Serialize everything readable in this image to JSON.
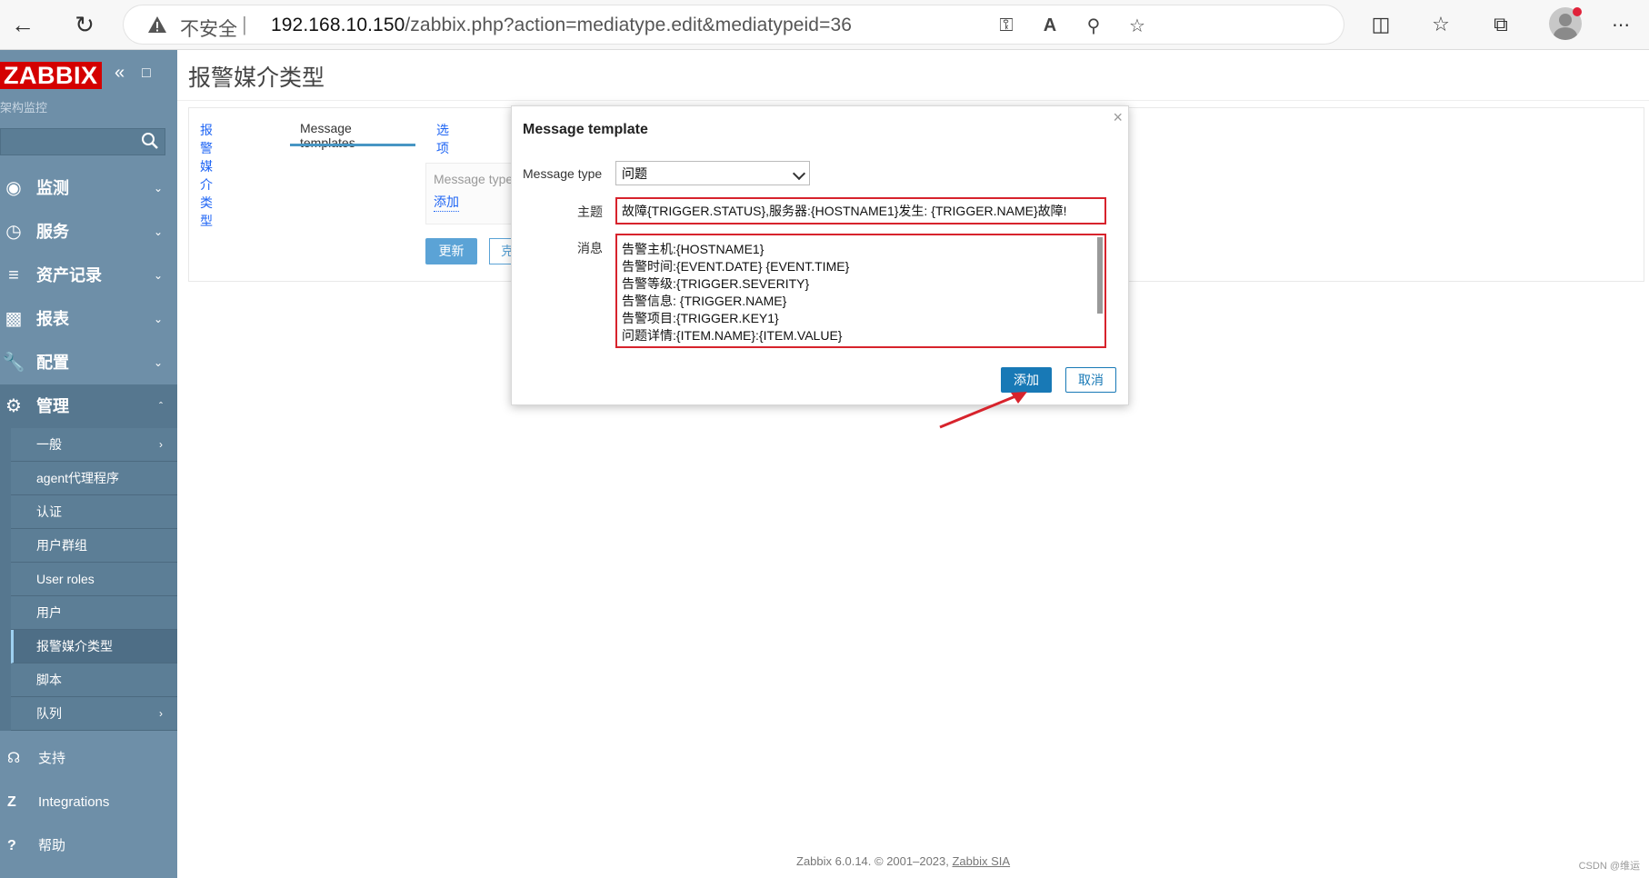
{
  "browser": {
    "security_label": "不安全",
    "url_host": "192.168.10.150",
    "url_path": "/zabbix.php?action=mediatype.edit&mediatypeid=36",
    "icons": [
      "back-icon",
      "reload-icon",
      "warning-icon",
      "key-icon",
      "read-aloud-icon",
      "zoom-out-icon",
      "add-favorite-icon",
      "split-screen-icon",
      "favorites-icon",
      "collections-icon",
      "profile-icon",
      "more-icon"
    ]
  },
  "sidebar": {
    "logo": "ZABBIX",
    "subtitle": "架构监控",
    "menu": [
      {
        "label": "监测",
        "icon": "eye-icon"
      },
      {
        "label": "服务",
        "icon": "clock-icon"
      },
      {
        "label": "资产记录",
        "icon": "list-icon"
      },
      {
        "label": "报表",
        "icon": "chart-icon"
      },
      {
        "label": "配置",
        "icon": "wrench-icon"
      },
      {
        "label": "管理",
        "icon": "gear-icon"
      }
    ],
    "submenu": [
      "一般",
      "agent代理程序",
      "认证",
      "用户群组",
      "User roles",
      "用户",
      "报警媒介类型",
      "脚本",
      "队列"
    ],
    "footer": [
      {
        "label": "支持",
        "icon": "headset-icon"
      },
      {
        "label": "Integrations",
        "icon": "z-icon"
      },
      {
        "label": "帮助",
        "icon": "question-icon"
      }
    ]
  },
  "main": {
    "page_title": "报警媒介类型",
    "tabs": [
      "报警媒介类型",
      "Message templates",
      "选项"
    ],
    "message_type_placeholder": "Message type",
    "add_link": "添加",
    "update_button": "更新",
    "clone_button": "克"
  },
  "modal": {
    "title": "Message template",
    "close": "×",
    "message_type_label": "Message type",
    "message_type_value": "问题",
    "subject_label": "主题",
    "subject_value": "故障{TRIGGER.STATUS},服务器:{HOSTNAME1}发生: {TRIGGER.NAME}故障!",
    "message_label": "消息",
    "message_lines": [
      "告警主机:{HOSTNAME1}",
      "告警时间:{EVENT.DATE} {EVENT.TIME}",
      "告警等级:{TRIGGER.SEVERITY}",
      "告警信息: {TRIGGER.NAME}",
      "告警项目:{TRIGGER.KEY1}",
      "问题详情:{ITEM.NAME}:{ITEM.VALUE}"
    ],
    "add_button": "添加",
    "cancel_button": "取消"
  },
  "footer": {
    "text": "Zabbix 6.0.14. © 2001–2023, ",
    "link": "Zabbix SIA"
  },
  "watermark": "CSDN @维运",
  "colors": {
    "sidebar": "#6e8fa8",
    "logo_red": "#d40000",
    "primary_button": "#1879b6",
    "highlight_red": "#d7232c"
  }
}
